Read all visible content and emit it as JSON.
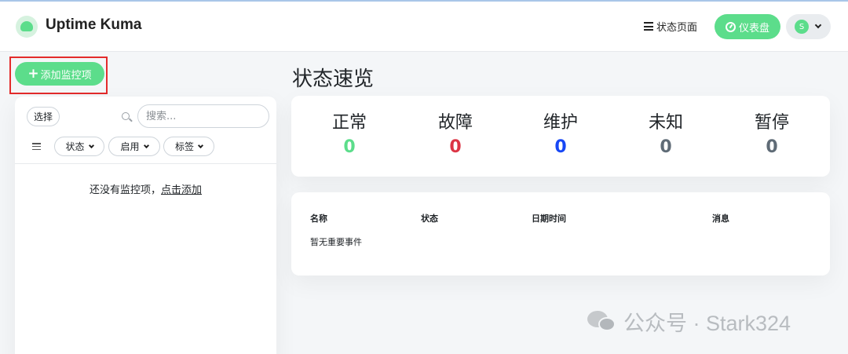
{
  "header": {
    "app_title": "Uptime Kuma",
    "status_page_label": "状态页面",
    "dashboard_label": "仪表盘",
    "avatar_letter": "S"
  },
  "sidebar": {
    "add_monitor_label": "添加监控项",
    "select_label": "选择",
    "search_placeholder": "搜索...",
    "filters": {
      "status": "状态",
      "active": "启用",
      "tags": "标签"
    },
    "empty_text": "还没有监控项，",
    "empty_link": "点击添加"
  },
  "main": {
    "title": "状态速览",
    "stats": {
      "up": {
        "label": "正常",
        "value": "0"
      },
      "down": {
        "label": "故障",
        "value": "0"
      },
      "maintenance": {
        "label": "维护",
        "value": "0"
      },
      "unknown": {
        "label": "未知",
        "value": "0"
      },
      "pause": {
        "label": "暂停",
        "value": "0"
      }
    },
    "events": {
      "columns": {
        "name": "名称",
        "status": "状态",
        "datetime": "日期时间",
        "message": "消息"
      },
      "empty": "暂无重要事件"
    }
  },
  "watermark": "公众号 · Stark324",
  "colors": {
    "primary": "#5cdd8b",
    "danger": "#dc3545",
    "maintenance": "#1747f5",
    "muted": "#5f6b76",
    "highlight": "#e32b2b"
  }
}
